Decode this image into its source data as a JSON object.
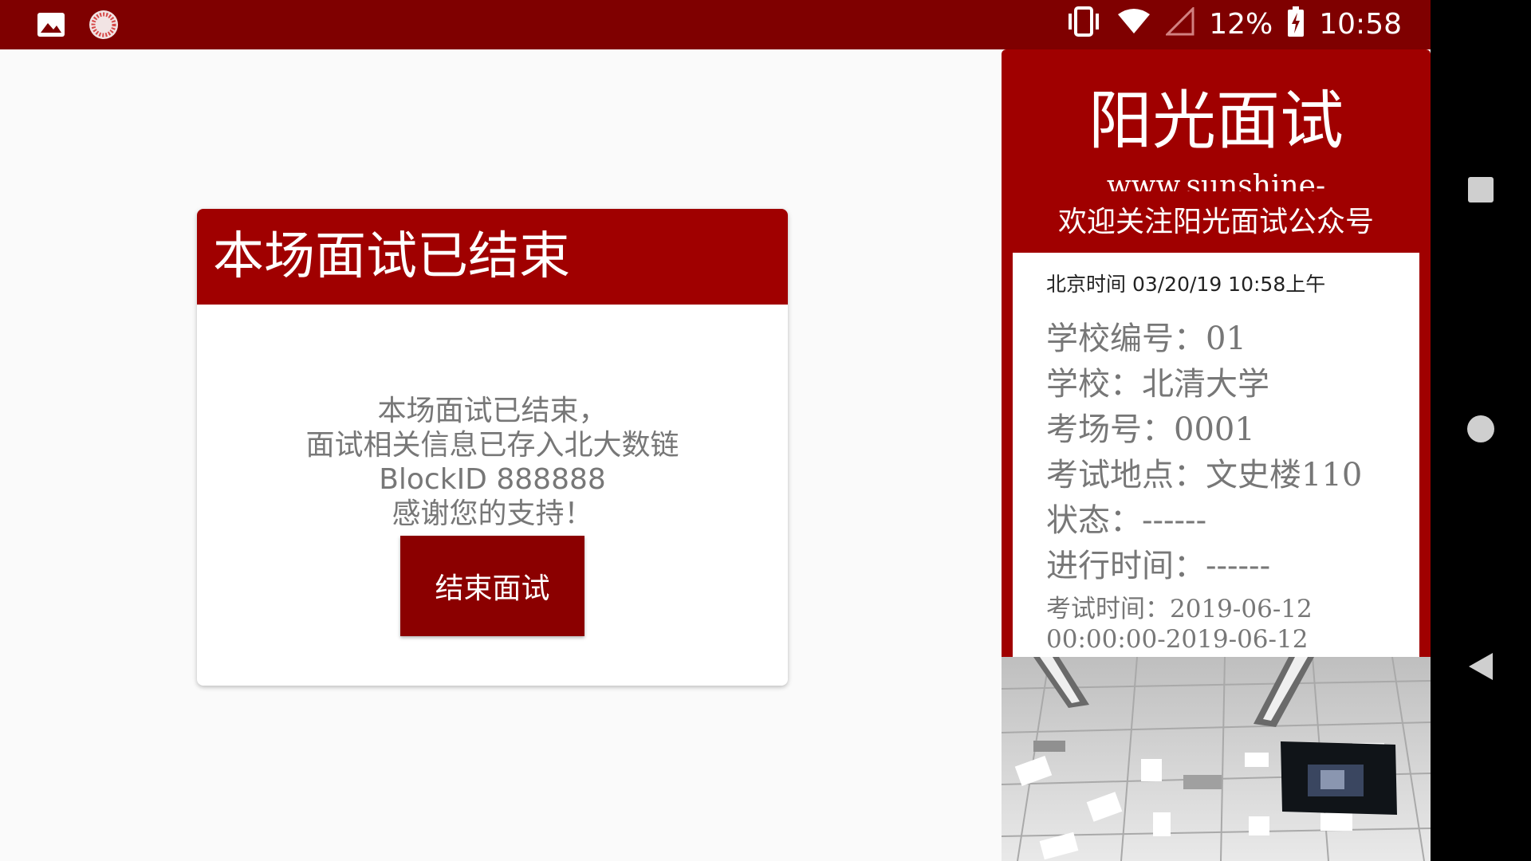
{
  "status_bar": {
    "left_icons": [
      "image-icon",
      "loading-icon"
    ],
    "right_icons": [
      "vibrate-icon",
      "wifi-icon",
      "no-signal-icon",
      "battery-charging-icon"
    ],
    "battery": "12%",
    "time": "10:58"
  },
  "nav_bar": {
    "icons": [
      "recent-apps-icon",
      "home-icon",
      "back-icon"
    ]
  },
  "end_card": {
    "title": "本场面试已结束",
    "message_lines": [
      "本场面试已结束，",
      "面试相关信息已存入北大数链",
      "BlockID 888888",
      "感谢您的支持！"
    ],
    "button_label": "结束面试"
  },
  "side_panel": {
    "title": "阳光面试",
    "url": "www.sunshine-",
    "welcome": "欢迎关注阳光面试公众号",
    "beijing_time": "北京时间 03/20/19 10:58上午",
    "rows": [
      "学校编号：01",
      "学校：北清大学",
      "考场号：0001",
      "考试地点：文史楼110",
      "状态：------",
      "进行时间：------"
    ],
    "exam_time": "考试时间：2019-06-12",
    "exam_time_cut": "00:00:00-2019-06-12"
  },
  "colors": {
    "status_bar": "#7f0000",
    "accent": "#a00000",
    "button": "#8b0000",
    "nav_bar": "#000000"
  }
}
